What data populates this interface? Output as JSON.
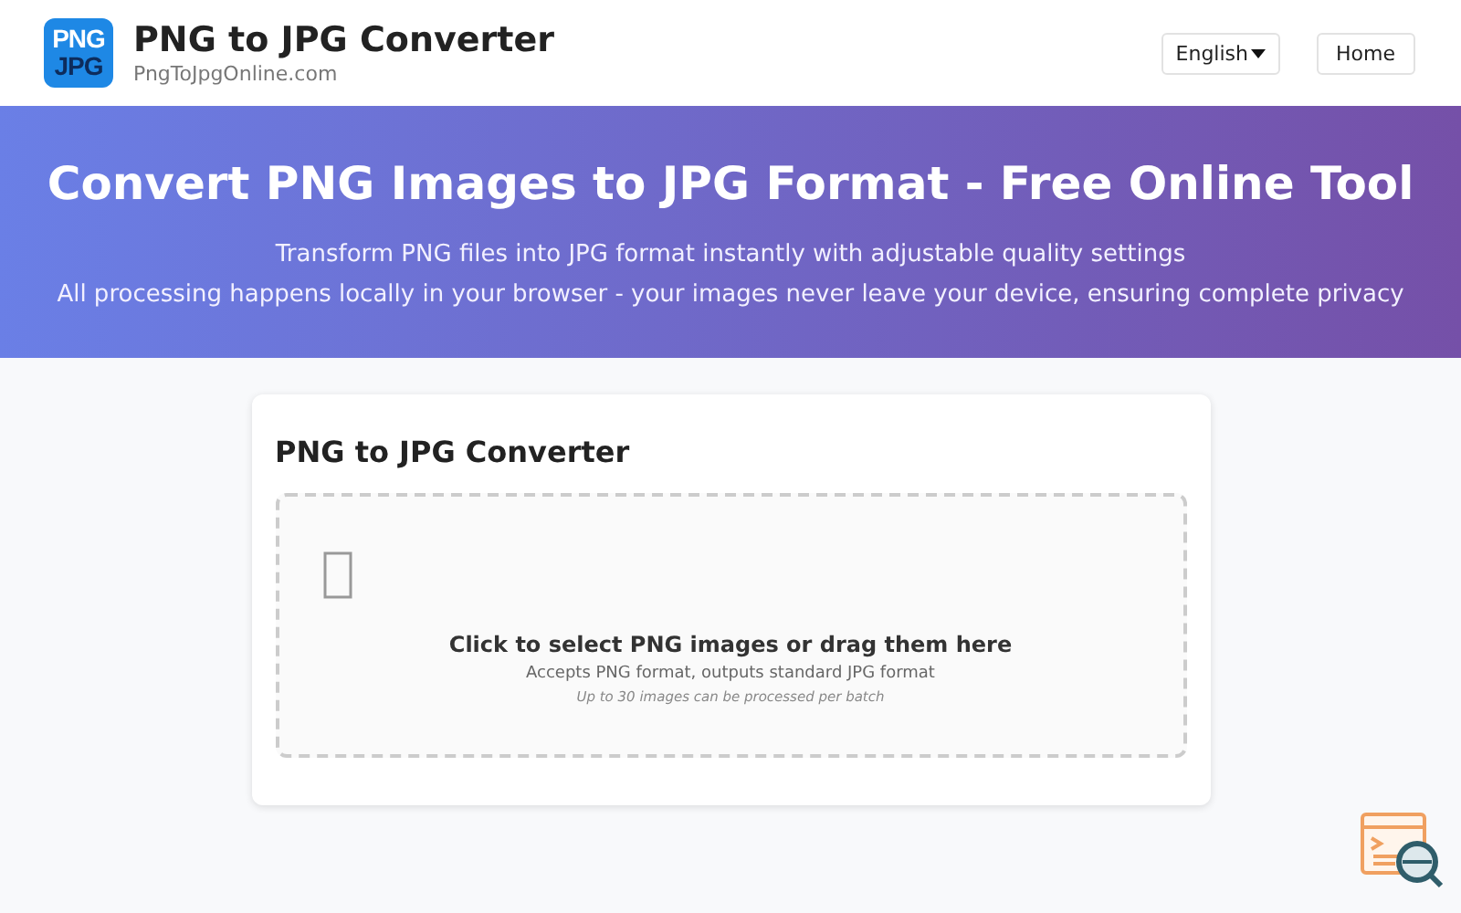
{
  "header": {
    "logo_lines": [
      "PNG",
      "JPG"
    ],
    "title": "PNG to JPG Converter",
    "subtitle": "PngToJpgOnline.com",
    "language": "English",
    "nav": [
      "Home"
    ]
  },
  "hero": {
    "title": "Convert PNG Images to JPG Format - Free Online Tool",
    "lines": [
      "Transform PNG files into JPG format instantly with adjustable quality settings",
      "All processing happens locally in your browser - your images never leave your device, ensuring complete privacy"
    ]
  },
  "converter": {
    "title": "PNG to JPG Converter",
    "drop_zone": {
      "prompt": "Click to select PNG images or drag them here",
      "formats": "Accepts PNG format, outputs standard JPG format",
      "limit": "Up to 30 images can be processed per batch"
    }
  }
}
